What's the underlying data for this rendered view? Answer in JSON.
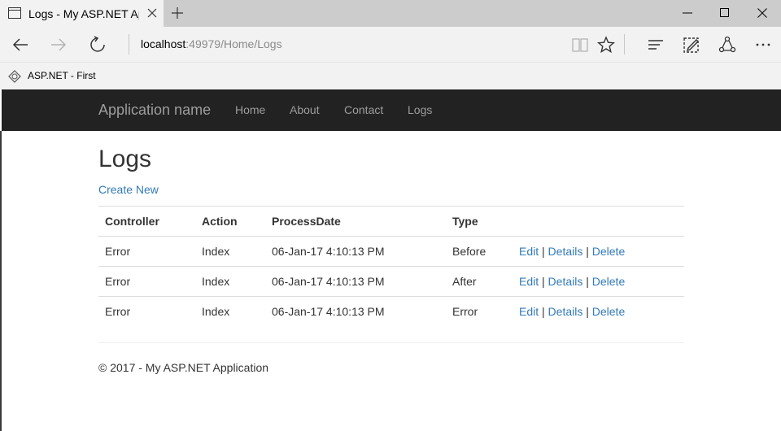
{
  "browser": {
    "tab_title": "Logs - My ASP.NET App",
    "address_host": "localhost",
    "address_rest": ":49979/Home/Logs",
    "favorite_label": "ASP.NET - First"
  },
  "site": {
    "brand": "Application name",
    "nav": [
      "Home",
      "About",
      "Contact",
      "Logs"
    ]
  },
  "page": {
    "title": "Logs",
    "create_new": "Create New"
  },
  "table": {
    "headers": [
      "Controller",
      "Action",
      "ProcessDate",
      "Type"
    ],
    "rows": [
      {
        "controller": "Error",
        "action": "Index",
        "date": "06-Jan-17 4:10:13 PM",
        "type": "Before"
      },
      {
        "controller": "Error",
        "action": "Index",
        "date": "06-Jan-17 4:10:13 PM",
        "type": "After"
      },
      {
        "controller": "Error",
        "action": "Index",
        "date": "06-Jan-17 4:10:13 PM",
        "type": "Error"
      }
    ],
    "actions": {
      "edit": "Edit",
      "details": "Details",
      "delete": "Delete",
      "separator": "|"
    }
  },
  "footer": {
    "text": "© 2017 - My ASP.NET Application"
  },
  "colors": {
    "navbar_bg": "#222222",
    "link": "#337ab7",
    "chrome_bg": "#f2f2f2",
    "tabstrip_bg": "#cccccc"
  }
}
